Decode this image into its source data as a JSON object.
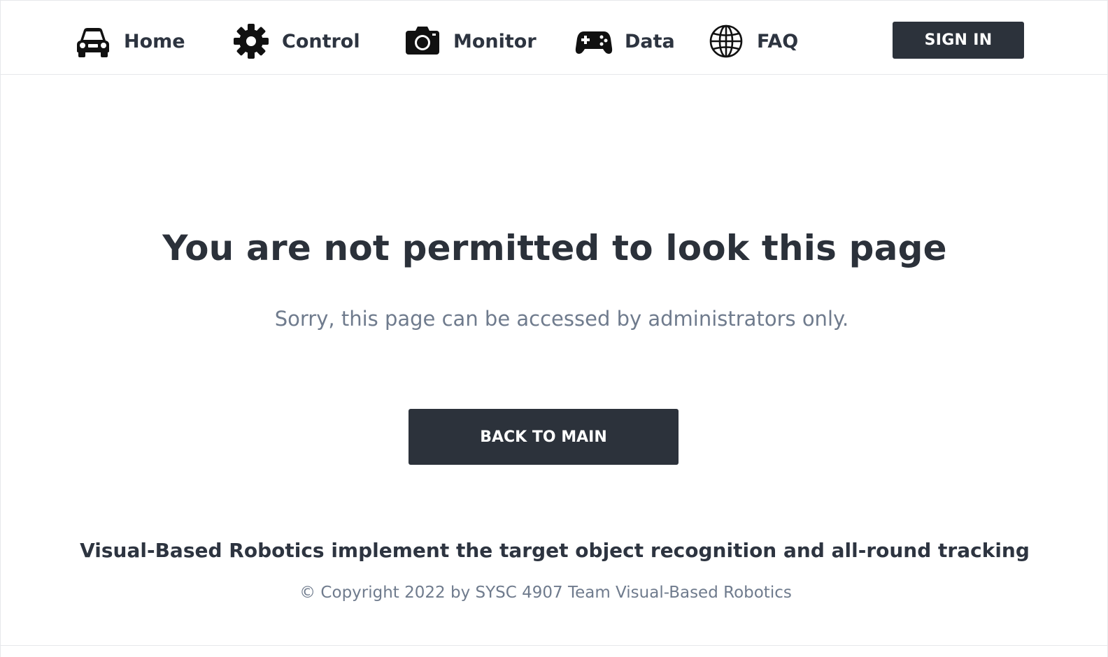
{
  "nav": {
    "items": [
      {
        "label": "Home",
        "icon": "car-icon"
      },
      {
        "label": "Control",
        "icon": "gear-icon"
      },
      {
        "label": "Monitor",
        "icon": "camera-icon"
      },
      {
        "label": "Data",
        "icon": "gamepad-icon"
      },
      {
        "label": "FAQ",
        "icon": "globe-icon"
      }
    ],
    "signin_label": "SIGN IN"
  },
  "main": {
    "headline": "You are not permitted to look this page",
    "subtext": "Sorry, this page can be accessed by administrators only.",
    "back_label": "BACK TO MAIN"
  },
  "footer": {
    "tagline": "Visual-Based Robotics implement the target object recognition and all-round tracking",
    "copyright": "© Copyright 2022 by SYSC 4907 Team Visual-Based Robotics"
  },
  "colors": {
    "text_dark": "#2d3440",
    "text_muted": "#6f7b8d",
    "button_bg": "#2c323b",
    "border": "#e6e8eb"
  }
}
